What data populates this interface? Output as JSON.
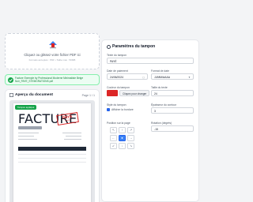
{
  "upload": {
    "title": "Cliquez ou glissez votre fichier PDF ici",
    "subtitle": "Formats acceptés : PDF • Taille max : 50MB"
  },
  "file": {
    "name": "Facture Exemple by Professional Moderne Minimaliste Beige Noir_PAYE_STEMGRATIONS.pdf"
  },
  "preview": {
    "title": "Aperçu du document",
    "page_indicator": "Page 1 / 1",
    "badge": "Tampon appliqué",
    "invoice_title": "FACTURE",
    "stamp_text": "PAYÉ",
    "stamp_sub": "Tampon"
  },
  "settings": {
    "title": "Paramètres du tampon",
    "stamp_text_label": "Texte du tampon",
    "stamp_text_value": "PAYÉ",
    "payment_date_label": "Date de paiement",
    "payment_date_value": "24/06/2024",
    "date_format_label": "Format de date",
    "date_format_value": "JJ/MM/AAAA",
    "color_label": "Couleur du tampon",
    "color_button": "Cliquez pour changer",
    "font_size_label": "Taille du texte",
    "font_size_value": "24",
    "style_label": "Style du tampon",
    "border_label": "Afficher la bordure",
    "border_width_label": "Épaisseur du contour",
    "border_width_value": "3",
    "position_label": "Position sur la page",
    "rotation_label": "Rotation (degrés)",
    "rotation_value": "-15"
  },
  "colors": {
    "stamp": "#dc2626",
    "accent": "#3b82f6",
    "success": "#16a34a"
  }
}
